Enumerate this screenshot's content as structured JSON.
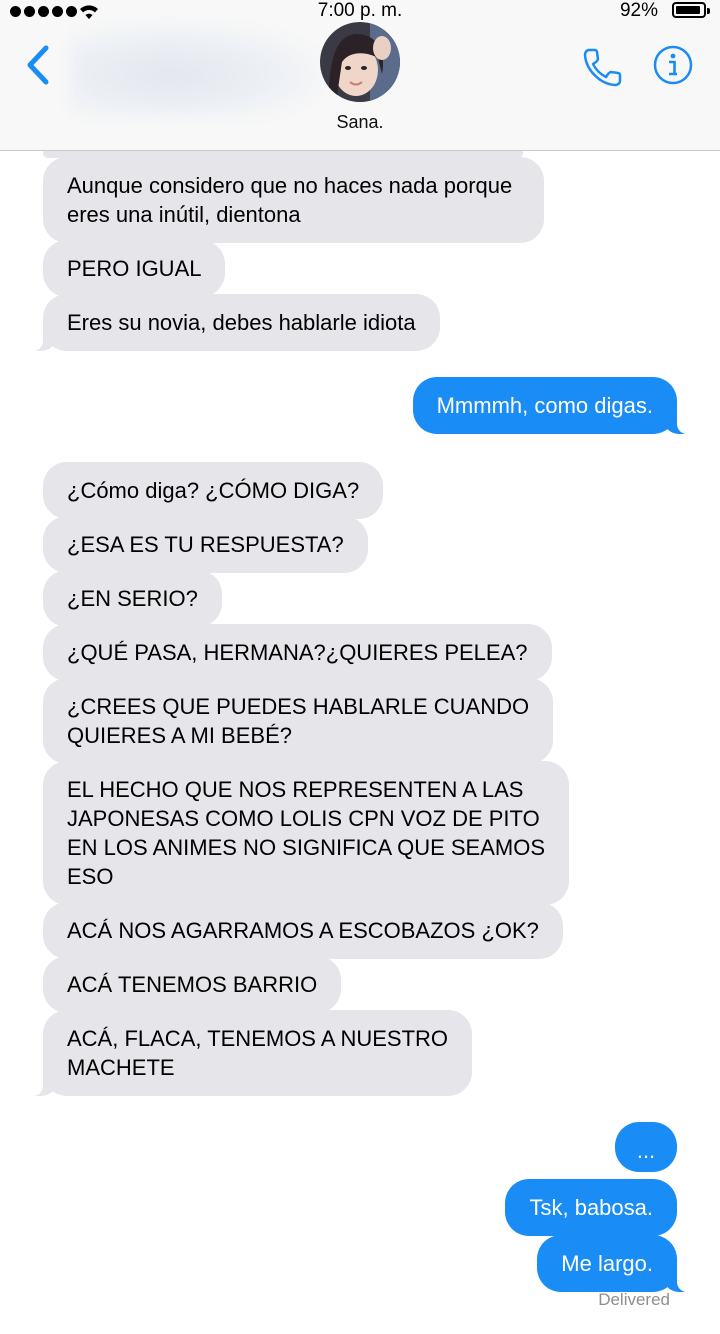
{
  "status_bar": {
    "time": "7:00 p. m.",
    "battery": "92%",
    "battery_level": 0.92
  },
  "header": {
    "contact_name": "Sana.",
    "back_icon": "chevron-left-icon",
    "call_icon": "phone-icon",
    "info_icon": "info-icon"
  },
  "colors": {
    "accent": "#1a8cf5",
    "incoming_bubble": "#e5e5ea",
    "delivered_text": "#8e8e93"
  },
  "messages": [
    {
      "dir": "in",
      "text": "Aunque considero que no haces nada porque\neres una inútil, dientona"
    },
    {
      "dir": "in",
      "text": "PERO IGUAL"
    },
    {
      "dir": "in",
      "text": "Eres su novia, debes hablarle idiota"
    },
    {
      "dir": "out",
      "text": "Mmmmh, como digas."
    },
    {
      "dir": "in",
      "text": "¿Cómo diga? ¿CÓMO DIGA?"
    },
    {
      "dir": "in",
      "text": "¿ESA ES TU RESPUESTA?"
    },
    {
      "dir": "in",
      "text": "¿EN SERIO?"
    },
    {
      "dir": "in",
      "text": "¿QUÉ PASA, HERMANA?¿QUIERES PELEA?"
    },
    {
      "dir": "in",
      "text": "¿CREES QUE PUEDES HABLARLE CUANDO\nQUIERES A MI BEBÉ?"
    },
    {
      "dir": "in",
      "text": "EL HECHO QUE NOS REPRESENTEN A LAS\nJAPONESAS COMO LOLIS CPN VOZ DE PITO\nEN LOS ANIMES NO SIGNIFICA QUE SEAMOS\nESO"
    },
    {
      "dir": "in",
      "text": "ACÁ NOS AGARRAMOS A ESCOBAZOS ¿OK?"
    },
    {
      "dir": "in",
      "text": "ACÁ TENEMOS BARRIO"
    },
    {
      "dir": "in",
      "text": "ACÁ, FLACA, TENEMOS A NUESTRO\nMACHETE"
    },
    {
      "dir": "out",
      "text": "..."
    },
    {
      "dir": "out",
      "text": "Tsk, babosa."
    },
    {
      "dir": "out",
      "text": "Me largo."
    }
  ],
  "delivered_label": "Delivered"
}
